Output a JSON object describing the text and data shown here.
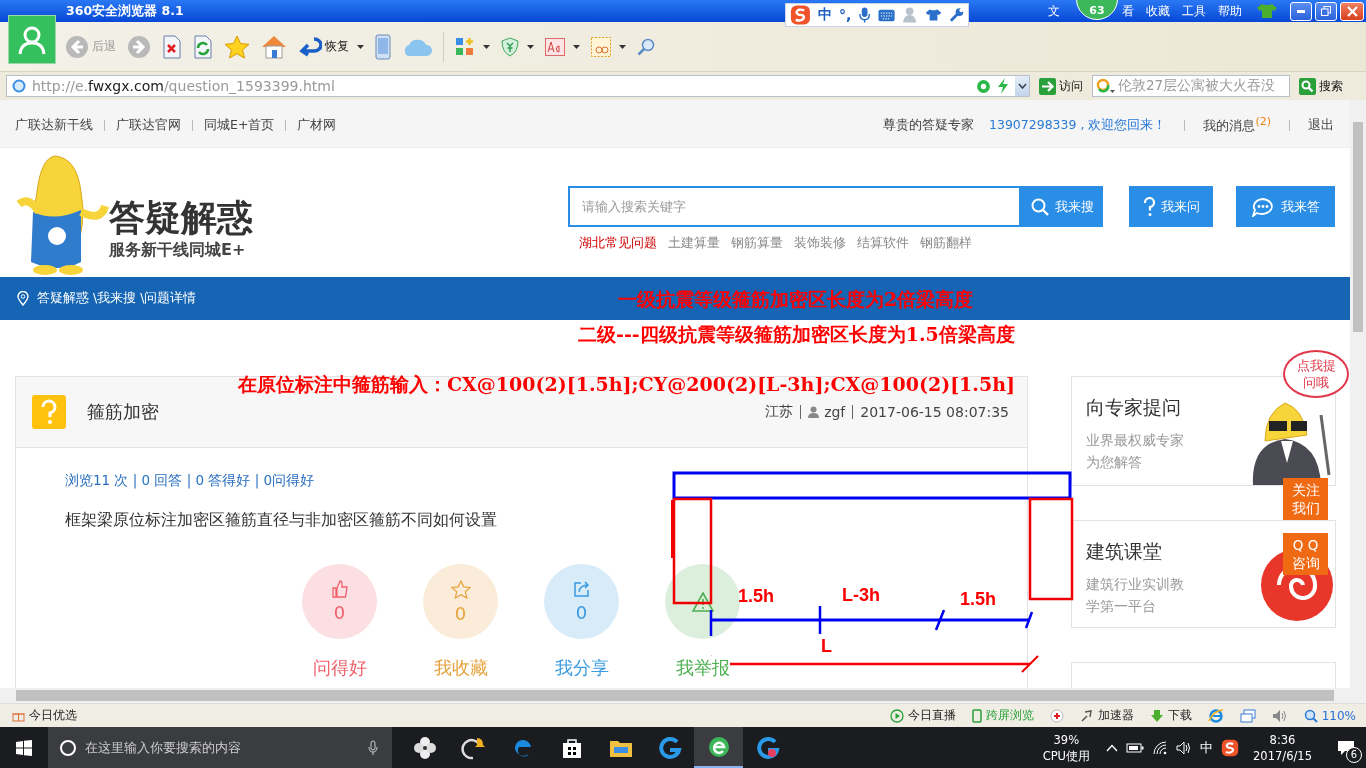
{
  "titlebar": {
    "title": "360安全浏览器 8.1",
    "menu": [
      "文",
      "看",
      "收藏",
      "工具",
      "帮助"
    ],
    "badge": "63"
  },
  "ime": {
    "mode": "中",
    "punct": "°,"
  },
  "toolbar": [
    {
      "kind": "back",
      "label": "后退"
    },
    {
      "kind": "forward"
    },
    {
      "kind": "stop"
    },
    {
      "kind": "refresh"
    },
    {
      "kind": "favorite"
    },
    {
      "kind": "home"
    },
    {
      "kind": "restore",
      "label": "恢复"
    },
    {
      "kind": "phone"
    },
    {
      "kind": "cloud"
    },
    {
      "kind": "apps"
    },
    {
      "kind": "shield"
    },
    {
      "kind": "font"
    },
    {
      "kind": "image"
    },
    {
      "kind": "zoom"
    }
  ],
  "address": {
    "prefix": "http://e.",
    "domain": "fwxgx.com",
    "path": "/question_1593399.html",
    "go": "访问",
    "search_value": "伦敦27层公寓被大火吞没",
    "search_button": "搜索"
  },
  "site_nav": {
    "links": [
      "广联达新干线",
      "广联达官网",
      "同城E+首页",
      "广材网"
    ],
    "greeting": "尊贵的答疑专家",
    "user": "13907298339 , 欢迎您回来！",
    "messages": "我的消息",
    "message_count": "(2)",
    "logout": "退出"
  },
  "header": {
    "logo_title": "答疑解惑",
    "logo_subtitle": "服务新干线同城E+",
    "search_placeholder": "请输入搜索关键字",
    "buttons": [
      {
        "kind": "search",
        "label": "我来搜"
      },
      {
        "kind": "ask",
        "label": "我来问"
      },
      {
        "kind": "answer",
        "label": "我来答"
      }
    ],
    "hot_links": [
      {
        "label": "湖北常见问题",
        "selected": true
      },
      {
        "label": "土建算量",
        "selected": false
      },
      {
        "label": "钢筋算量",
        "selected": false
      },
      {
        "label": "装饰装修",
        "selected": false
      },
      {
        "label": "结算软件",
        "selected": false
      },
      {
        "label": "钢筋翻样",
        "selected": false
      }
    ]
  },
  "breadcrumb": "答疑解惑 \\我来搜 \\问题详情",
  "question": {
    "title": "箍筋加密",
    "province": "江苏",
    "user": "zgf",
    "time": "2017-06-15 08:07:35",
    "stats": "浏览11 次 | 0 回答 | 0 答得好 | 0问得好",
    "text": "框架梁原位标注加密区箍筋直径与非加密区箍筋不同如何设置",
    "actions": [
      {
        "kind": "like",
        "count": "0",
        "label": "问得好",
        "color": "#f0616e"
      },
      {
        "kind": "favorite",
        "count": "0",
        "label": "我收藏",
        "color": "#e6a23c"
      },
      {
        "kind": "share",
        "count": "0",
        "label": "我分享",
        "color": "#3a9be0"
      },
      {
        "kind": "report",
        "label": "我举报",
        "color": "#4caf50"
      }
    ]
  },
  "sidebar": {
    "bubble": "点我提问哦",
    "follow": "关注我们",
    "qq": "Q Q咨询",
    "cards": [
      {
        "kind": "expert",
        "title": "向专家提问",
        "subtitle": "业界最权威专家为您解答"
      },
      {
        "kind": "course",
        "title": "建筑课堂",
        "subtitle": "建筑行业实训教学第一平台"
      }
    ]
  },
  "annotations": [
    "一级抗震等级箍筋加密区长度为2倍梁高度",
    "二级---四级抗震等级箍筋加密区长度为1.5倍梁高度",
    "在原位标注中箍筋输入：CX@100(2)[1.5h];CY@200(2)[L-3h];CX@100(2)[1.5h]"
  ],
  "diagram": {
    "labels": [
      "1.5h",
      "L-3h",
      "1.5h",
      "L"
    ]
  },
  "statusbar": {
    "left": "今日优选",
    "items": [
      {
        "kind": "live",
        "label": "今日直播"
      },
      {
        "kind": "screen",
        "label": "跨屏浏览"
      },
      {
        "kind": "plugin"
      },
      {
        "kind": "boost",
        "label": "加速器"
      },
      {
        "kind": "download",
        "label": "下载"
      },
      {
        "kind": "ie"
      },
      {
        "kind": "window"
      },
      {
        "kind": "volume"
      },
      {
        "kind": "zoom",
        "label": "110%"
      }
    ]
  },
  "taskbar": {
    "search_placeholder": "在这里输入你要搜索的内容",
    "apps": [
      {
        "kind": "fan",
        "selected": false
      },
      {
        "kind": "bell",
        "selected": false
      },
      {
        "kind": "edge",
        "selected": false
      },
      {
        "kind": "store",
        "selected": false
      },
      {
        "kind": "folder",
        "selected": false
      },
      {
        "kind": "swirl",
        "selected": false
      },
      {
        "kind": "browser",
        "selected": true
      },
      {
        "kind": "swirl2",
        "selected": false
      }
    ],
    "cpu": "39%",
    "cpu_label": "CPU使用",
    "ime": "中",
    "time": "8:36",
    "date": "2017/6/15",
    "notifications": "6"
  }
}
